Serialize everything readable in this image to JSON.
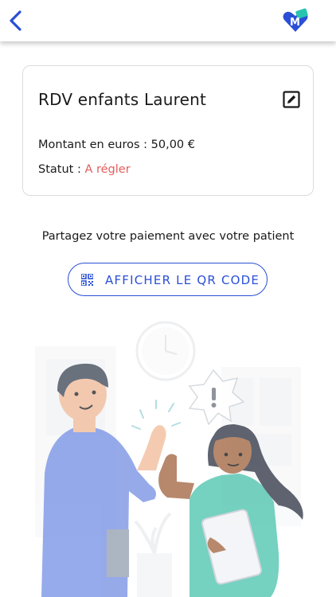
{
  "header": {
    "back_icon": "chevron-left-icon",
    "logo_icon": "app-logo-icon",
    "accent_color": "#2a4fd6"
  },
  "appointment": {
    "title": "RDV enfants Laurent",
    "edit_icon": "edit-icon",
    "amount_label": "Montant en euros :",
    "amount_value": "50,00 €",
    "status_label": "Statut :",
    "status_value": "A régler",
    "status_color": "#e35d5d"
  },
  "share": {
    "text": "Partagez votre paiement avec votre patient",
    "qr_button_label": "AFFICHER LE QR CODE",
    "qr_icon": "qr-code-icon"
  },
  "illustration": {
    "icon": "high-five-illustration"
  }
}
